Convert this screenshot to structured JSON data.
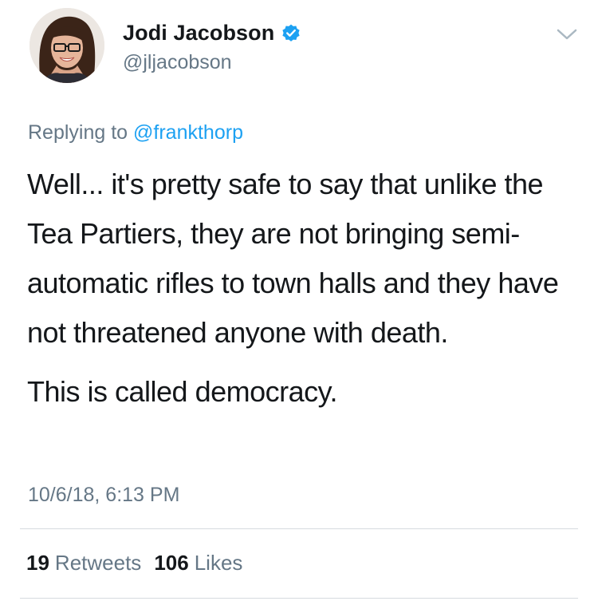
{
  "author": {
    "display_name": "Jodi Jacobson",
    "handle": "@jljacobson",
    "verified_icon": "verified-badge-icon",
    "avatar_icon": "profile-photo"
  },
  "menu_icon": "chevron-down-icon",
  "reply": {
    "prefix": "Replying to",
    "to_handle": "@frankthorp"
  },
  "tweet": {
    "paragraph_1": "Well... it's pretty safe to say that unlike the Tea Partiers, they are not bringing semi-automatic rifles to town halls and they have not threatened anyone with death.",
    "paragraph_2": "This is called democracy.",
    "timestamp": "10/6/18, 6:13 PM"
  },
  "stats": {
    "retweets_count": "19",
    "retweets_label": "Retweets",
    "likes_count": "106",
    "likes_label": "Likes"
  },
  "colors": {
    "link": "#1da1f2",
    "secondary_text": "#657786",
    "primary_text": "#14171a",
    "divider": "#d6dbdf"
  }
}
